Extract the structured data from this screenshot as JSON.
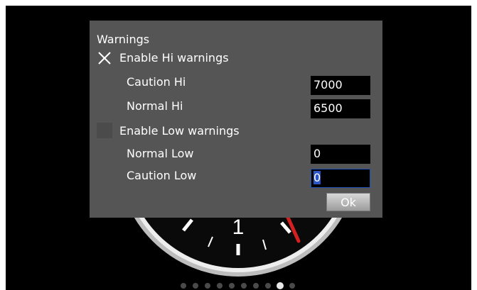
{
  "dialog": {
    "title": "Warnings",
    "hi": {
      "enabled": true,
      "label": "Enable Hi warnings",
      "caution_label": "Caution Hi",
      "caution_value": "7000",
      "normal_label": "Normal Hi",
      "normal_value": "6500"
    },
    "low": {
      "enabled": false,
      "label": "Enable Low warnings",
      "normal_label": "Normal Low",
      "normal_value": "0",
      "caution_label": "Caution Low",
      "caution_value": "0"
    },
    "ok_label": "Ok"
  },
  "gauge": {
    "tick_label": "1"
  },
  "pager": {
    "page_count": 10,
    "active_index": 8
  },
  "colors": {
    "background": "#000000",
    "dialog_bg": "#555555",
    "needle": "#d42020",
    "focus": "#2a56c8"
  }
}
